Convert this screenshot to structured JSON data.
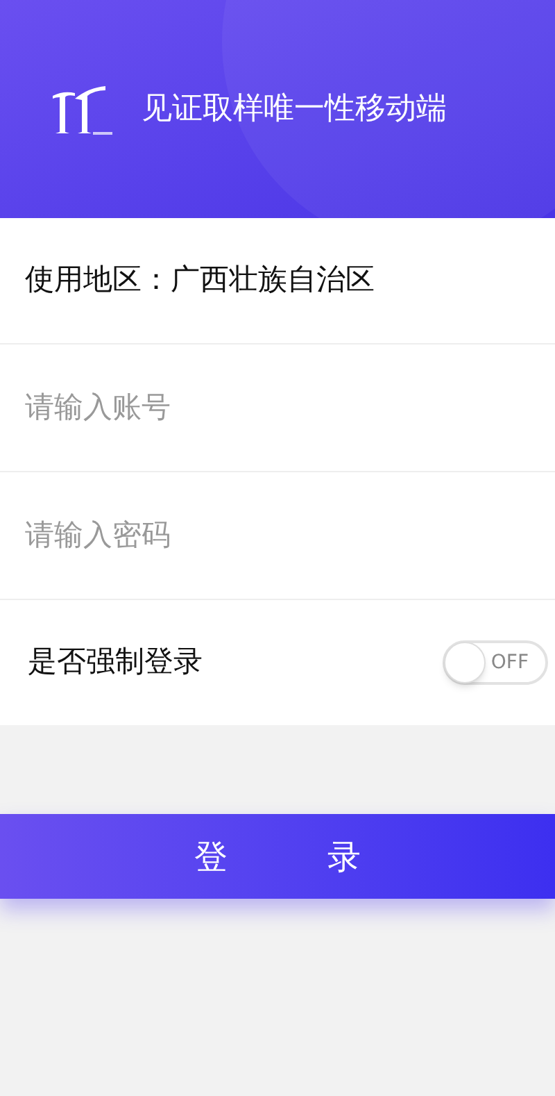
{
  "header": {
    "title": "见证取样唯一性移动端"
  },
  "region": {
    "label": "使用地区：广西壮族自治区"
  },
  "account": {
    "placeholder": "请输入账号"
  },
  "password": {
    "placeholder": "请输入密码"
  },
  "force_login": {
    "label": "是否强制登录",
    "on": false,
    "state_text": "OFF"
  },
  "login_button": {
    "label": "登　　　录"
  }
}
